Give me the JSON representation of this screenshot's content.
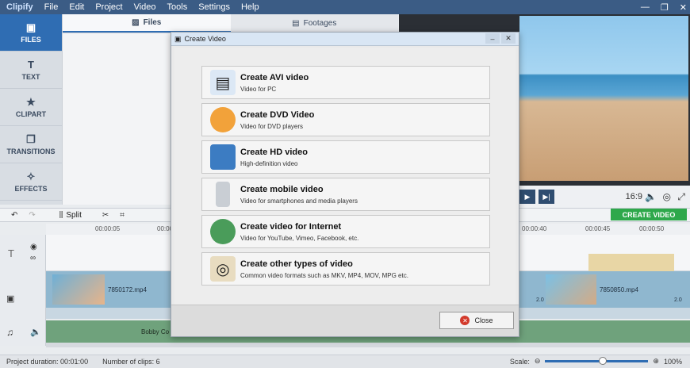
{
  "app": {
    "logo": "Clipify"
  },
  "menu": [
    "File",
    "Edit",
    "Project",
    "Video",
    "Tools",
    "Settings",
    "Help"
  ],
  "window_controls": [
    "—",
    "❐",
    "✕"
  ],
  "sidebar": [
    {
      "label": "FILES",
      "icon": "folder-icon"
    },
    {
      "label": "TEXT",
      "icon": "text-icon"
    },
    {
      "label": "CLIPART",
      "icon": "star-icon"
    },
    {
      "label": "TRANSITIONS",
      "icon": "transitions-icon"
    },
    {
      "label": "EFFECTS",
      "icon": "wand-icon"
    }
  ],
  "file_tabs": [
    {
      "label": "Files",
      "icon": "image-icon"
    },
    {
      "label": "Footages",
      "icon": "film-icon"
    }
  ],
  "player": {
    "ratio": "16:9"
  },
  "toolbar": {
    "split": "Split",
    "create_video": "CREATE VIDEO"
  },
  "ruler": {
    "left": [
      "00:00:05",
      "00:00:"
    ],
    "right": [
      "00:00:40",
      "00:00:45",
      "00:00:50"
    ]
  },
  "clips": {
    "clip1": "7850172.mp4",
    "clip2": "7850850.mp4",
    "audio": "Bobby Co",
    "duration_badge": "2.0"
  },
  "status": {
    "duration": "Project duration:  00:01:00",
    "clips": "Number of clips: 6",
    "scale": "Scale:",
    "zoom": "100%"
  },
  "dialog": {
    "title": "Create Video",
    "options": [
      {
        "title": "Create AVI video",
        "sub": "Video for PC",
        "icon": "avi-icon"
      },
      {
        "title": "Create DVD Video",
        "sub": "Video for DVD players",
        "icon": "dvd-icon"
      },
      {
        "title": "Create HD video",
        "sub": "High-definition video",
        "icon": "monitor-icon"
      },
      {
        "title": "Create mobile video",
        "sub": "Video for smartphones and media players",
        "icon": "phone-icon"
      },
      {
        "title": "Create video for Internet",
        "sub": "Video for YouTube, Vimeo, Facebook, etc.",
        "icon": "globe-icon"
      },
      {
        "title": "Create other types of video",
        "sub": "Common video formats such as MKV, MP4, MOV, MPG etc.",
        "icon": "reel-icon"
      }
    ],
    "close_label": "Close"
  }
}
